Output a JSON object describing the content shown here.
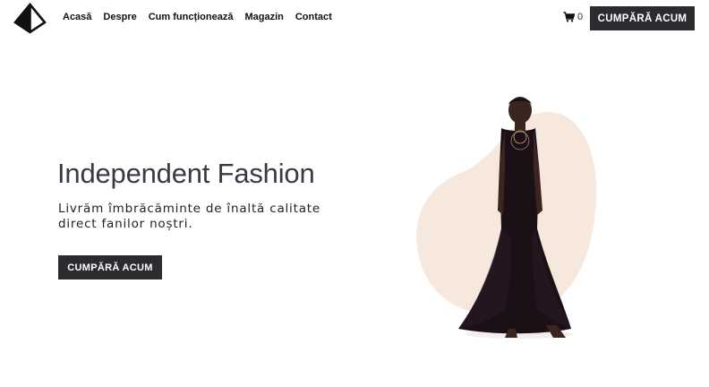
{
  "header": {
    "logo_icon": "diamond-triangle-logo",
    "nav": [
      {
        "label": "Acasă"
      },
      {
        "label": "Despre"
      },
      {
        "label": "Cum funcționează"
      },
      {
        "label": "Magazin"
      },
      {
        "label": "Contact"
      }
    ],
    "cart": {
      "icon": "cart-icon",
      "count": "0"
    },
    "cta_label": "CUMPĂRĂ ACUM"
  },
  "hero": {
    "title": "Independent Fashion",
    "subtitle": "Livrăm îmbrăcăminte de înaltă calitate direct fanilor noștri.",
    "cta_label": "CUMPĂRĂ ACUM",
    "blob_color": "#f6e8dc",
    "button_color": "#2b2b30"
  }
}
